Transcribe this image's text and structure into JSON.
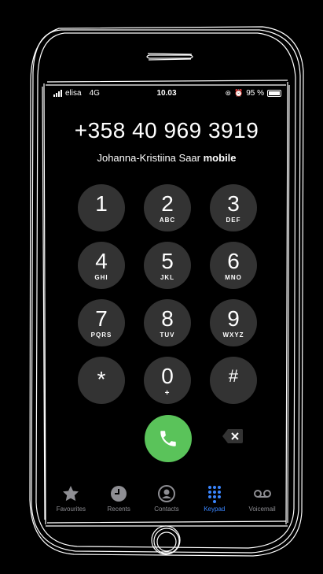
{
  "status": {
    "carrier": "elisa",
    "network": "4G",
    "time": "10.03",
    "battery": "95 %",
    "battery_level": 0.95
  },
  "call": {
    "number": "+358 40 969 3919",
    "contact_name": "Johanna-Kristiina Saar",
    "contact_label": "mobile"
  },
  "keypad": {
    "keys": [
      {
        "digit": "1",
        "letters": ""
      },
      {
        "digit": "2",
        "letters": "ABC"
      },
      {
        "digit": "3",
        "letters": "DEF"
      },
      {
        "digit": "4",
        "letters": "GHI"
      },
      {
        "digit": "5",
        "letters": "JKL"
      },
      {
        "digit": "6",
        "letters": "MNO"
      },
      {
        "digit": "7",
        "letters": "PQRS"
      },
      {
        "digit": "8",
        "letters": "TUV"
      },
      {
        "digit": "9",
        "letters": "WXYZ"
      },
      {
        "digit": "*",
        "letters": ""
      },
      {
        "digit": "0",
        "letters": "+"
      },
      {
        "digit": "#",
        "letters": ""
      }
    ]
  },
  "colors": {
    "call_green": "#5ac35a",
    "active_tab": "#3a86ff",
    "key_bg": "#333333"
  },
  "tabs": [
    {
      "label": "Favourites",
      "icon": "star-icon"
    },
    {
      "label": "Recents",
      "icon": "clock-icon"
    },
    {
      "label": "Contacts",
      "icon": "person-icon"
    },
    {
      "label": "Keypad",
      "icon": "keypad-icon",
      "active": true
    },
    {
      "label": "Voicemail",
      "icon": "voicemail-icon"
    }
  ]
}
